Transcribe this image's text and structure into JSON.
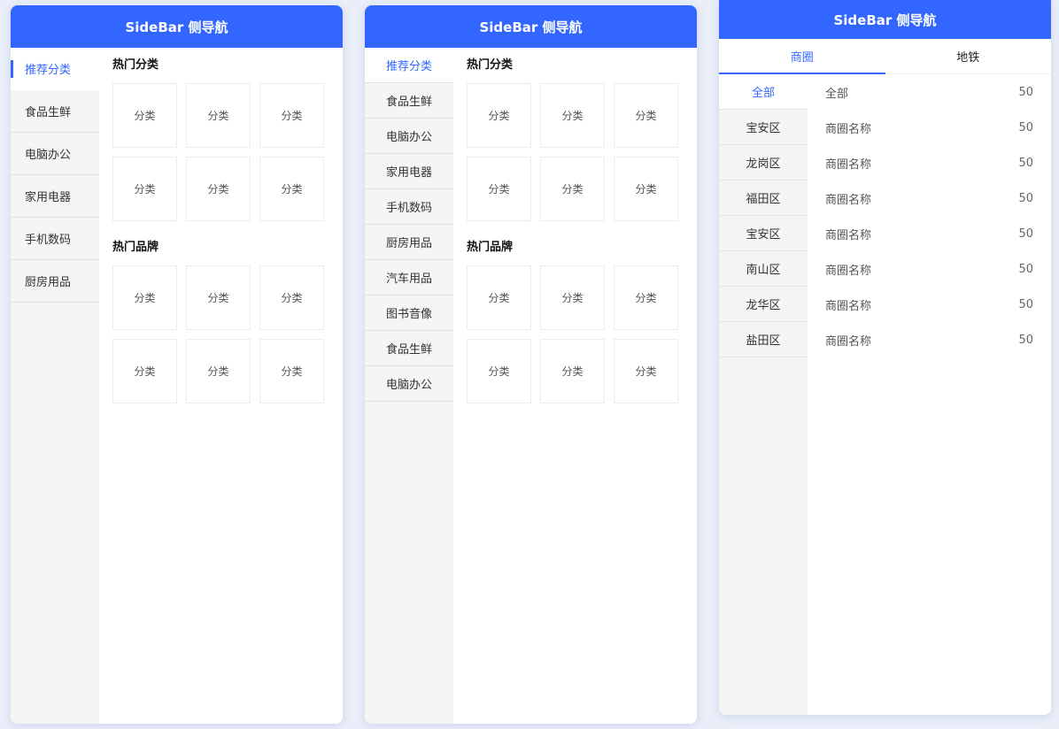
{
  "colors": {
    "primary": "#3366ff",
    "sidebar_bg": "#f5f5f5"
  },
  "panel1": {
    "title": "SideBar 侧导航",
    "sidebar": [
      "推荐分类",
      "食品生鲜",
      "电脑办公",
      "家用电器",
      "手机数码",
      "厨房用品"
    ],
    "active_index": 0,
    "sections": [
      {
        "title": "热门分类",
        "cells": [
          "分类",
          "分类",
          "分类",
          "分类",
          "分类",
          "分类"
        ]
      },
      {
        "title": "热门品牌",
        "cells": [
          "分类",
          "分类",
          "分类",
          "分类",
          "分类",
          "分类"
        ]
      }
    ]
  },
  "panel2": {
    "title": "SideBar 侧导航",
    "sidebar": [
      "推荐分类",
      "食品生鲜",
      "电脑办公",
      "家用电器",
      "手机数码",
      "厨房用品",
      "汽车用品",
      "图书音像",
      "食品生鲜",
      "电脑办公"
    ],
    "active_index": 0,
    "sections": [
      {
        "title": "热门分类",
        "cells": [
          "分类",
          "分类",
          "分类",
          "分类",
          "分类",
          "分类"
        ]
      },
      {
        "title": "热门品牌",
        "cells": [
          "分类",
          "分类",
          "分类",
          "分类",
          "分类",
          "分类"
        ]
      }
    ]
  },
  "panel3": {
    "title": "SideBar 侧导航",
    "tabs": [
      "商圈",
      "地铁"
    ],
    "active_tab": 0,
    "sidebar": [
      "全部",
      "宝安区",
      "龙岗区",
      "福田区",
      "宝安区",
      "南山区",
      "龙华区",
      "盐田区"
    ],
    "active_index": 0,
    "rows": [
      {
        "name": "全部",
        "count": "50"
      },
      {
        "name": "商圈名称",
        "count": "50"
      },
      {
        "name": "商圈名称",
        "count": "50"
      },
      {
        "name": "商圈名称",
        "count": "50"
      },
      {
        "name": "商圈名称",
        "count": "50"
      },
      {
        "name": "商圈名称",
        "count": "50"
      },
      {
        "name": "商圈名称",
        "count": "50"
      },
      {
        "name": "商圈名称",
        "count": "50"
      }
    ]
  }
}
